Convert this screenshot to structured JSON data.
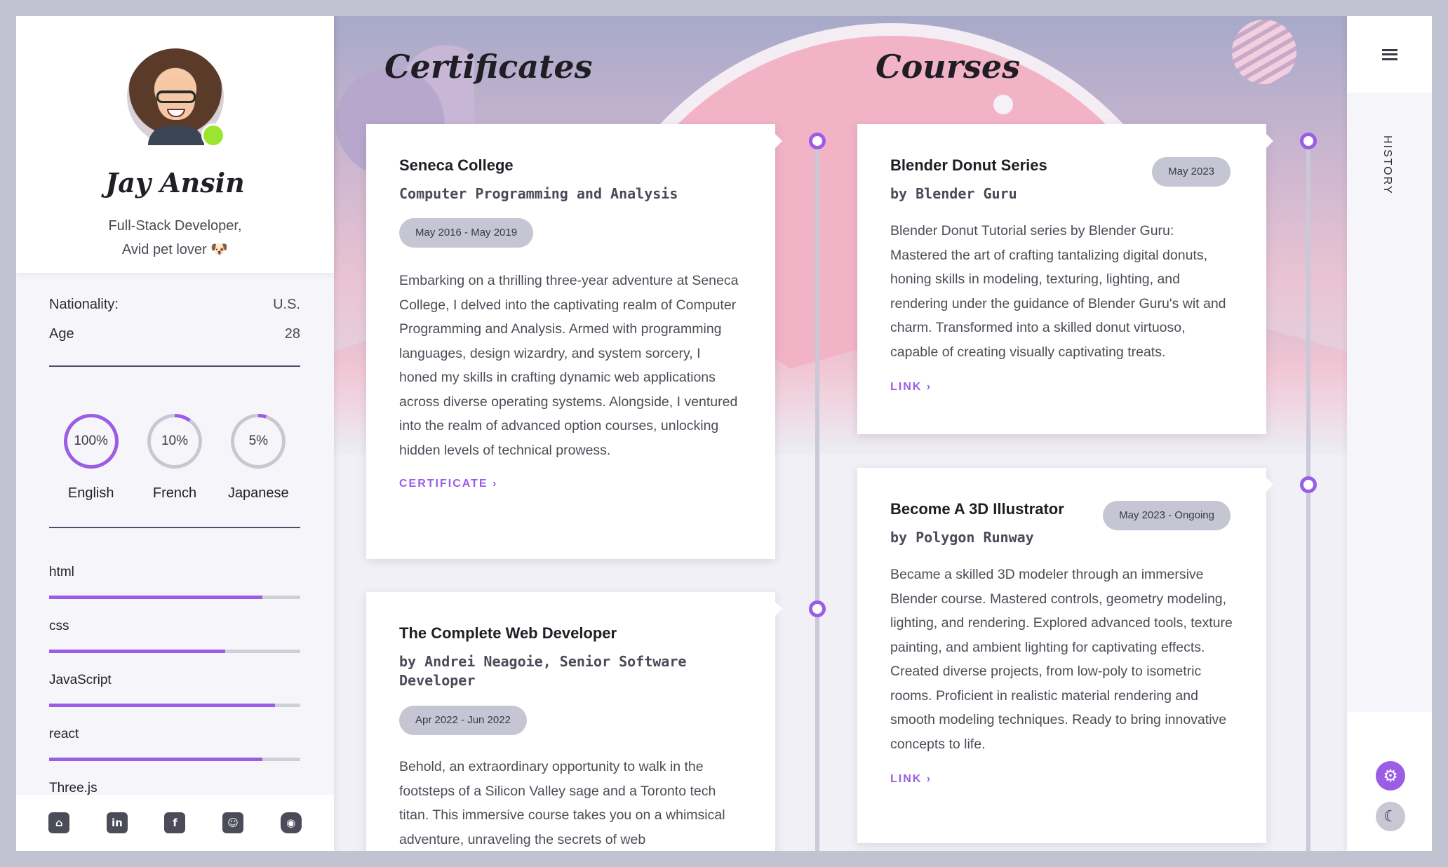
{
  "profile": {
    "name": "Jay Ansin",
    "role_line1": "Full-Stack Developer,",
    "role_line2": "Avid pet lover 🐶"
  },
  "info": [
    {
      "label": "Nationality:",
      "value": "U.S."
    },
    {
      "label": "Age",
      "value": "28"
    }
  ],
  "languages": [
    {
      "name": "English",
      "percent": 100,
      "label": "100%"
    },
    {
      "name": "French",
      "percent": 10,
      "label": "10%"
    },
    {
      "name": "Japanese",
      "percent": 5,
      "label": "5%"
    }
  ],
  "skills": [
    {
      "name": "html",
      "level": 0.85
    },
    {
      "name": "css",
      "level": 0.7
    },
    {
      "name": "JavaScript",
      "level": 0.9
    },
    {
      "name": "react",
      "level": 0.85
    },
    {
      "name": "Three.js"
    }
  ],
  "socials": [
    "github-icon",
    "linkedin-icon",
    "facebook-icon",
    "snapchat-icon",
    "discord-icon"
  ],
  "sections": {
    "certificates": "Certificates",
    "courses": "Courses"
  },
  "certificates": [
    {
      "title": "Seneca College",
      "subtitle": "Computer Programming and Analysis",
      "date": "May 2016 - May 2019",
      "body": "Embarking on a thrilling three-year adventure at Seneca College, I delved into the captivating realm of Computer Programming and Analysis. Armed with programming languages, design wizardry, and system sorcery, I honed my skills in crafting dynamic web applications across diverse operating systems. Alongside, I ventured into the realm of advanced option courses, unlocking hidden levels of technical prowess.",
      "link": "CERTIFICATE ›"
    },
    {
      "title": "The Complete Web Developer",
      "subtitle": "by Andrei Neagoie, Senior Software Developer",
      "date": "Apr 2022 - Jun 2022",
      "body": "Behold, an extraordinary opportunity to walk in the footsteps of a Silicon Valley sage and a Toronto tech titan. This immersive course takes you on a whimsical adventure, unraveling the secrets of web"
    }
  ],
  "courses": [
    {
      "title": "Blender Donut Series",
      "subtitle": "by Blender Guru",
      "date": "May 2023",
      "body": "Blender Donut Tutorial series by Blender Guru: Mastered the art of crafting tantalizing digital donuts, honing skills in modeling, texturing, lighting, and rendering under the guidance of Blender Guru's wit and charm. Transformed into a skilled donut virtuoso, capable of creating visually captivating treats.",
      "link": "LINK ›"
    },
    {
      "title": "Become A 3D Illustrator",
      "subtitle": "by Polygon Runway",
      "date": "May 2023 - Ongoing",
      "body": "Became a skilled 3D modeler through an immersive Blender course. Mastered controls, geometry modeling, lighting, and rendering. Explored advanced tools, texture painting, and ambient lighting for captivating effects. Created diverse projects, from low-poly to isometric rooms. Proficient in realistic material rendering and smooth modeling techniques. Ready to bring innovative concepts to life.",
      "link": "LINK ›"
    }
  ],
  "rail": {
    "history": "HISTORY",
    "menu_icon": "hamburger-menu-icon",
    "settings_icon": "gear-icon",
    "theme_icon": "moon-icon"
  },
  "colors": {
    "accent": "#9b5de5",
    "status_online": "#9be430",
    "badge": "#c5c5d3"
  }
}
